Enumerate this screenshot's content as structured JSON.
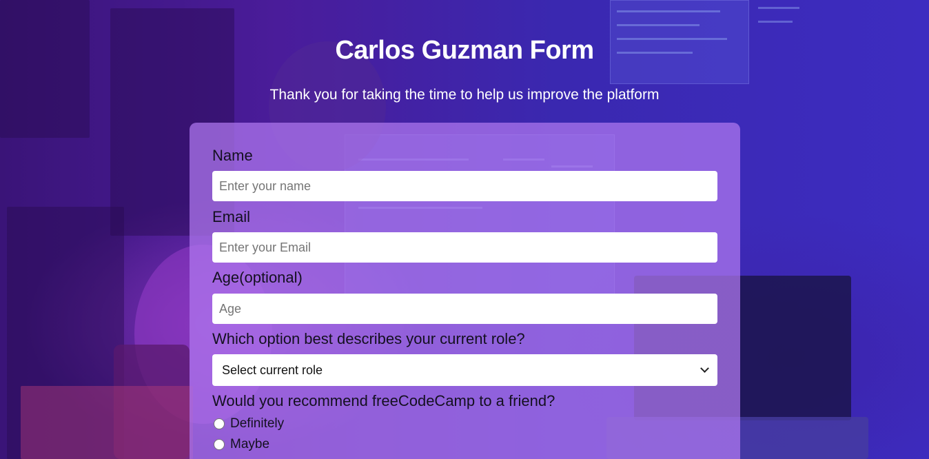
{
  "page": {
    "title": "Carlos Guzman Form",
    "description": "Thank you for taking the time to help us improve the platform"
  },
  "form": {
    "name": {
      "label": "Name",
      "placeholder": "Enter your name",
      "value": ""
    },
    "email": {
      "label": "Email",
      "placeholder": "Enter your Email",
      "value": ""
    },
    "age": {
      "label": "Age(optional)",
      "placeholder": "Age",
      "value": ""
    },
    "role": {
      "label": "Which option best describes your current role?",
      "selected": "Select current role"
    },
    "recommend": {
      "label": "Would you recommend freeCodeCamp to a friend?",
      "options": [
        "Definitely",
        "Maybe"
      ]
    }
  },
  "colors": {
    "form_panel": "#b078f0",
    "background": "#3a1e9a",
    "label_text": "#141020",
    "heading_text": "#ffffff"
  },
  "icons": {
    "select_arrow": "chevron-down-icon"
  }
}
